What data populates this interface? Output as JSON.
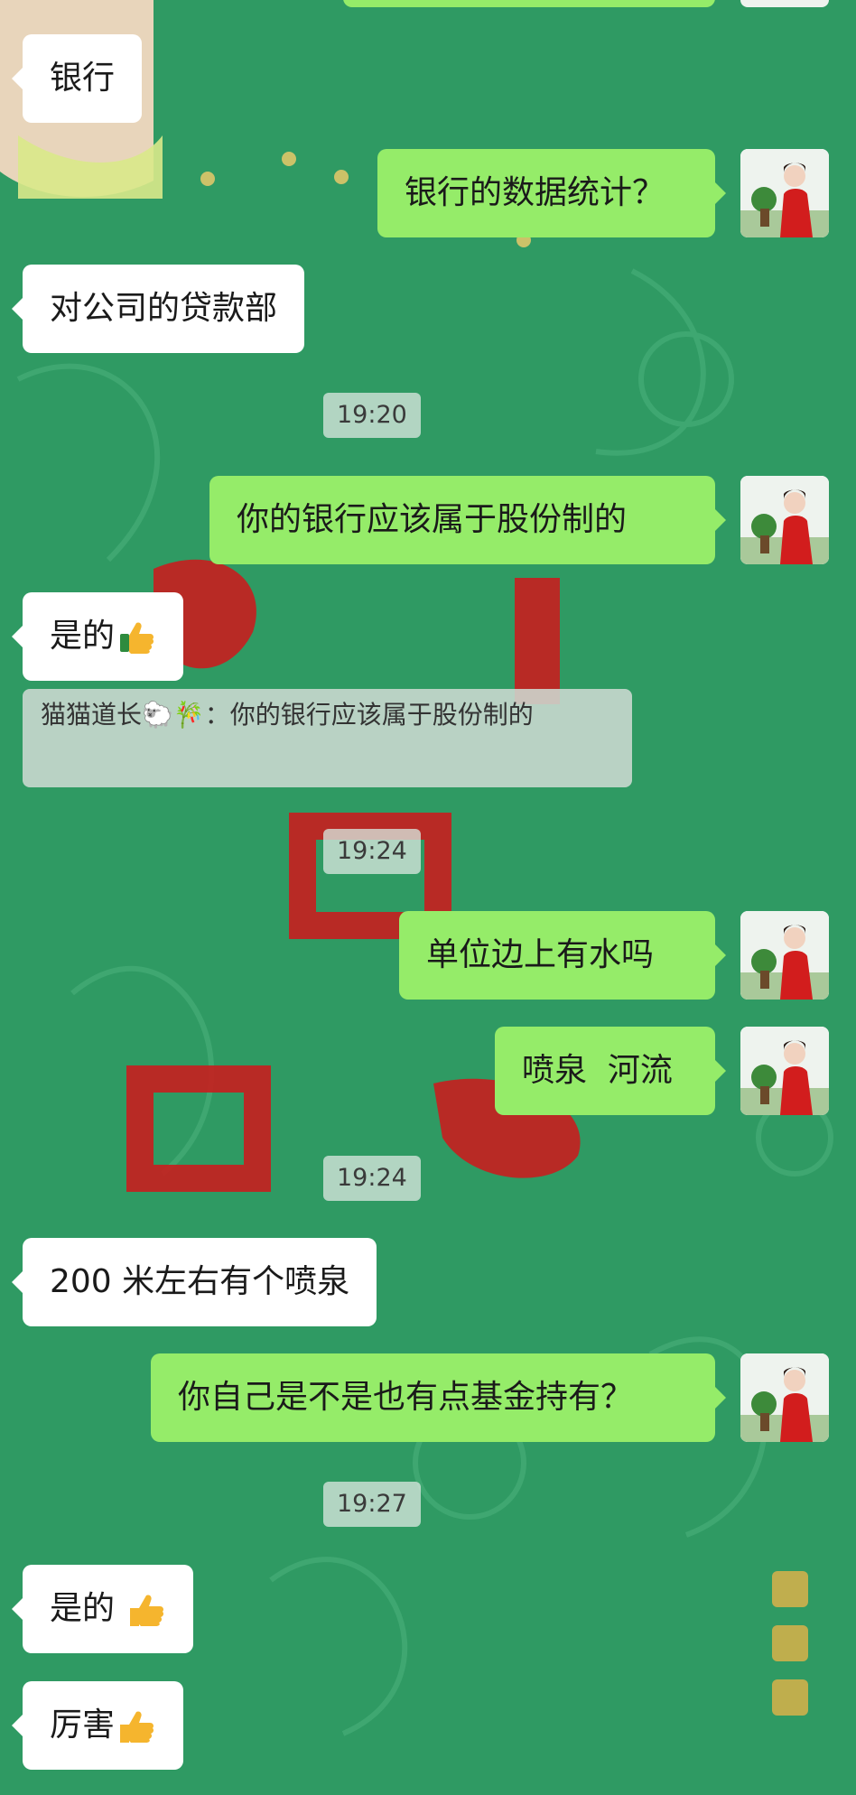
{
  "messages": [
    {
      "id": "m0",
      "side": "in",
      "text": "银行",
      "emoji": ""
    },
    {
      "id": "m1",
      "side": "out",
      "text": "银行的数据统计？",
      "emoji": ""
    },
    {
      "id": "m2",
      "side": "in",
      "text": "对公司的贷款部",
      "emoji": ""
    },
    {
      "id": "m3",
      "side": "out",
      "text": "你的银行应该属于股份制的",
      "emoji": ""
    },
    {
      "id": "m4",
      "side": "in",
      "text": "是的",
      "emoji": "thumbs-up"
    },
    {
      "id": "m5",
      "side": "out",
      "text": "单位边上有水吗",
      "emoji": ""
    },
    {
      "id": "m6",
      "side": "out",
      "text": "喷泉  河流",
      "emoji": ""
    },
    {
      "id": "m7",
      "side": "in",
      "text": "200 米左右有个喷泉",
      "emoji": ""
    },
    {
      "id": "m8",
      "side": "out",
      "text": "你自己是不是也有点基金持有？",
      "emoji": ""
    },
    {
      "id": "m9",
      "side": "in",
      "text": "是的 ",
      "emoji": "thumbs-up"
    },
    {
      "id": "m10",
      "side": "in",
      "text": "厉害",
      "emoji": "thumbs-up"
    }
  ],
  "quote": {
    "sender": "猫猫道长🐑🎋",
    "separator": "：",
    "text": "你的银行应该属于股份制的"
  },
  "timestamps": [
    "19:20",
    "19:24",
    "19:24",
    "19:27"
  ],
  "colors": {
    "background": "#2f9a63",
    "outgoing_bubble": "#95ec69",
    "incoming_bubble": "#ffffff"
  },
  "icons": {
    "emoji": "thumbs-up-emoji",
    "avatar": "user-avatar"
  }
}
